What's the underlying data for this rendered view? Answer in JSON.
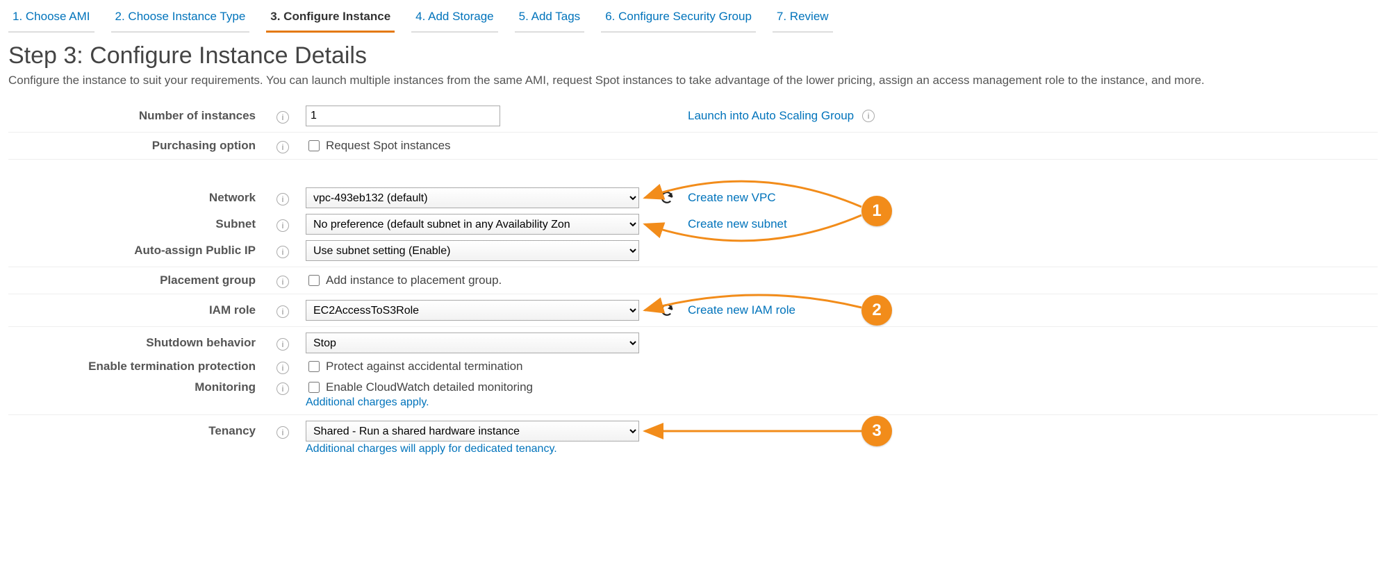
{
  "wizard": [
    {
      "label": "1. Choose AMI"
    },
    {
      "label": "2. Choose Instance Type"
    },
    {
      "label": "3. Configure Instance",
      "active": true
    },
    {
      "label": "4. Add Storage"
    },
    {
      "label": "5. Add Tags"
    },
    {
      "label": "6. Configure Security Group"
    },
    {
      "label": "7. Review"
    }
  ],
  "page": {
    "title": "Step 3: Configure Instance Details",
    "desc": "Configure the instance to suit your requirements. You can launch multiple instances from the same AMI, request Spot instances to take advantage of the lower pricing, assign an access management role to the instance, and more."
  },
  "form": {
    "num_instances": {
      "label": "Number of instances",
      "value": "1",
      "side": "Launch into Auto Scaling Group"
    },
    "purchasing": {
      "label": "Purchasing option",
      "chk": "Request Spot instances"
    },
    "network": {
      "label": "Network",
      "value": "vpc-493eb132 (default)",
      "side": "Create new VPC"
    },
    "subnet": {
      "label": "Subnet",
      "value": "No preference (default subnet in any Availability Zon",
      "side": "Create new subnet"
    },
    "public_ip": {
      "label": "Auto-assign Public IP",
      "value": "Use subnet setting (Enable)"
    },
    "placement": {
      "label": "Placement group",
      "chk": "Add instance to placement group."
    },
    "iam": {
      "label": "IAM role",
      "value": "EC2AccessToS3Role",
      "side": "Create new IAM role"
    },
    "shutdown": {
      "label": "Shutdown behavior",
      "value": "Stop"
    },
    "term_protect": {
      "label": "Enable termination protection",
      "chk": "Protect against accidental termination"
    },
    "monitoring": {
      "label": "Monitoring",
      "chk": "Enable CloudWatch detailed monitoring",
      "note": "Additional charges apply."
    },
    "tenancy": {
      "label": "Tenancy",
      "value": "Shared - Run a shared hardware instance",
      "note": "Additional charges will apply for dedicated tenancy."
    }
  },
  "annotations": {
    "badge1": "1",
    "badge2": "2",
    "badge3": "3"
  }
}
